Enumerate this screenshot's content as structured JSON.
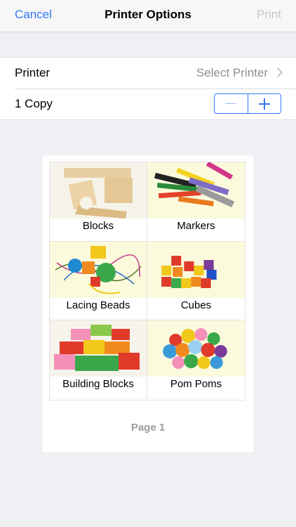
{
  "navbar": {
    "cancel": "Cancel",
    "title": "Printer Options",
    "print": "Print"
  },
  "settings": {
    "printer_label": "Printer",
    "printer_value": "Select Printer",
    "copies_label": "1 Copy"
  },
  "preview": {
    "items": [
      {
        "label": "Blocks"
      },
      {
        "label": "Markers"
      },
      {
        "label": "Lacing Beads"
      },
      {
        "label": "Cubes"
      },
      {
        "label": "Building Blocks"
      },
      {
        "label": "Pom Poms"
      }
    ],
    "page_label": "Page 1"
  },
  "colors": {
    "accent": "#3478f6",
    "disabled": "#c7c7cc",
    "secondary": "#8e8e93"
  }
}
